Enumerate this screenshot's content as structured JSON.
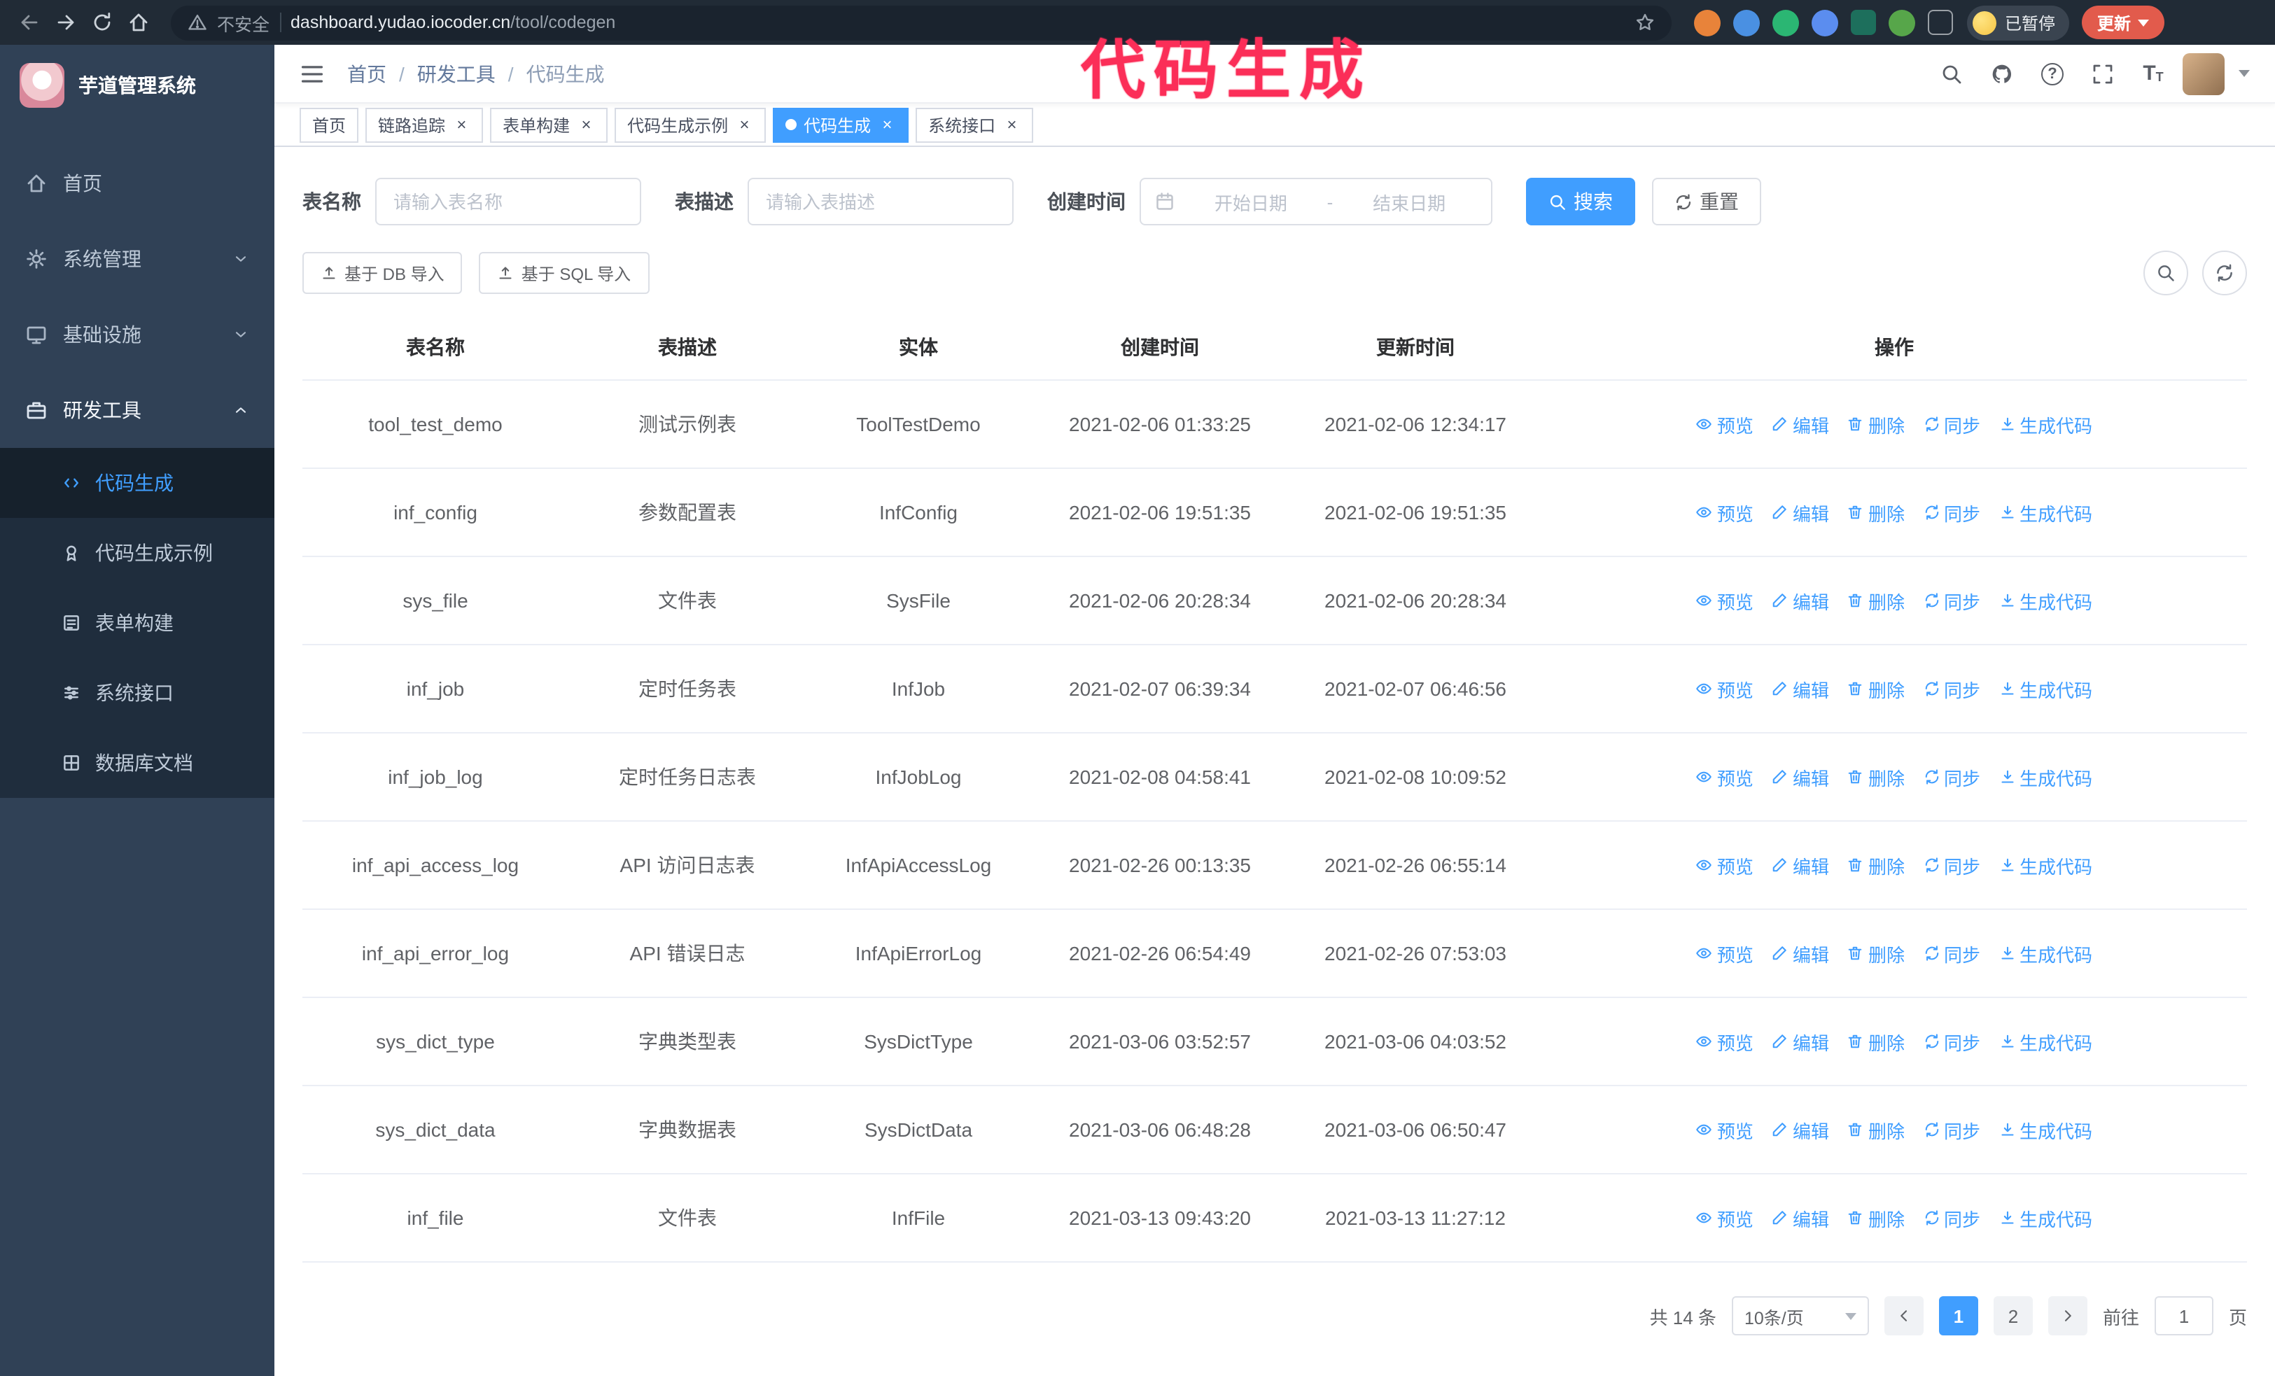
{
  "colors": {
    "accent": "#409EFF",
    "sidebar_bg": "#304156",
    "submenu_bg": "#1f2d3d",
    "chrome_bg": "#212b36",
    "annotation": "#fb2e58",
    "update_button": "#e25b4c"
  },
  "browser": {
    "security_label": "不安全",
    "url_host": "dashboard.yudao.iocoder.cn",
    "url_path": "/tool/codegen",
    "profile_chip": "已暂停",
    "update_button": "更新"
  },
  "annotation": {
    "text": "代码生成"
  },
  "sidebar": {
    "logo_title": "芋道管理系统",
    "items": [
      {
        "label": "首页"
      },
      {
        "label": "系统管理"
      },
      {
        "label": "基础设施"
      },
      {
        "label": "研发工具"
      }
    ],
    "sub_items": [
      {
        "label": "代码生成"
      },
      {
        "label": "代码生成示例"
      },
      {
        "label": "表单构建"
      },
      {
        "label": "系统接口"
      },
      {
        "label": "数据库文档"
      }
    ]
  },
  "header": {
    "breadcrumb": [
      "首页",
      "研发工具",
      "代码生成"
    ],
    "separator": "/"
  },
  "tabs": {
    "items": [
      {
        "label": "首页"
      },
      {
        "label": "链路追踪"
      },
      {
        "label": "表单构建"
      },
      {
        "label": "代码生成示例"
      },
      {
        "label": "代码生成"
      },
      {
        "label": "系统接口"
      }
    ]
  },
  "filters": {
    "table_name_label": "表名称",
    "table_name_placeholder": "请输入表名称",
    "table_desc_label": "表描述",
    "table_desc_placeholder": "请输入表描述",
    "create_time_label": "创建时间",
    "date_start_placeholder": "开始日期",
    "date_separator": "-",
    "date_end_placeholder": "结束日期",
    "search_button": "搜索",
    "reset_button": "重置"
  },
  "toolbar": {
    "import_db": "基于 DB 导入",
    "import_sql": "基于 SQL 导入"
  },
  "table": {
    "columns": [
      "表名称",
      "表描述",
      "实体",
      "创建时间",
      "更新时间",
      "操作"
    ],
    "op_labels": [
      "预览",
      "编辑",
      "删除",
      "同步",
      "生成代码"
    ],
    "rows": [
      {
        "name": "tool_test_demo",
        "desc": "测试示例表",
        "entity": "ToolTestDemo",
        "created": "2021-02-06 01:33:25",
        "updated": "2021-02-06 12:34:17"
      },
      {
        "name": "inf_config",
        "desc": "参数配置表",
        "entity": "InfConfig",
        "created": "2021-02-06 19:51:35",
        "updated": "2021-02-06 19:51:35"
      },
      {
        "name": "sys_file",
        "desc": "文件表",
        "entity": "SysFile",
        "created": "2021-02-06 20:28:34",
        "updated": "2021-02-06 20:28:34"
      },
      {
        "name": "inf_job",
        "desc": "定时任务表",
        "entity": "InfJob",
        "created": "2021-02-07 06:39:34",
        "updated": "2021-02-07 06:46:56"
      },
      {
        "name": "inf_job_log",
        "desc": "定时任务日志表",
        "entity": "InfJobLog",
        "created": "2021-02-08 04:58:41",
        "updated": "2021-02-08 10:09:52"
      },
      {
        "name": "inf_api_access_log",
        "desc": "API 访问日志表",
        "entity": "InfApiAccessLog",
        "created": "2021-02-26 00:13:35",
        "updated": "2021-02-26 06:55:14"
      },
      {
        "name": "inf_api_error_log",
        "desc": "API 错误日志",
        "entity": "InfApiErrorLog",
        "created": "2021-02-26 06:54:49",
        "updated": "2021-02-26 07:53:03"
      },
      {
        "name": "sys_dict_type",
        "desc": "字典类型表",
        "entity": "SysDictType",
        "created": "2021-03-06 03:52:57",
        "updated": "2021-03-06 04:03:52"
      },
      {
        "name": "sys_dict_data",
        "desc": "字典数据表",
        "entity": "SysDictData",
        "created": "2021-03-06 06:48:28",
        "updated": "2021-03-06 06:50:47"
      },
      {
        "name": "inf_file",
        "desc": "文件表",
        "entity": "InfFile",
        "created": "2021-03-13 09:43:20",
        "updated": "2021-03-13 11:27:12"
      }
    ]
  },
  "pagination": {
    "total": "共 14 条",
    "page_size": "10条/页",
    "pages": [
      "1",
      "2"
    ],
    "goto_label": "前往",
    "goto_value": "1",
    "unit": "页"
  }
}
